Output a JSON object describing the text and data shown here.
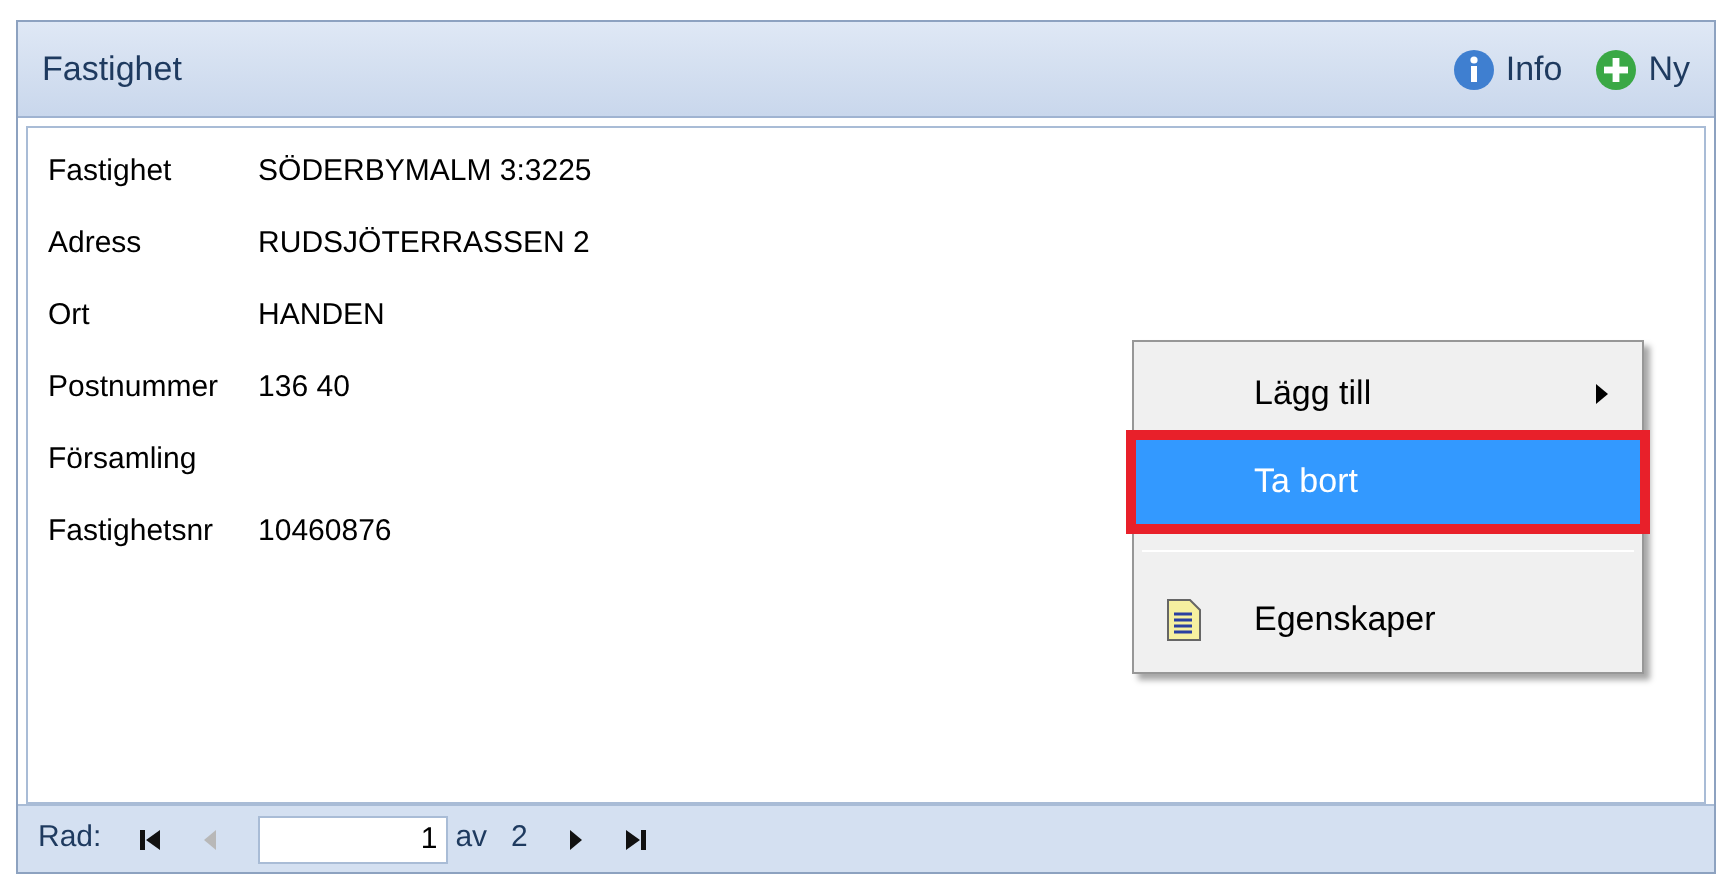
{
  "panel": {
    "title": "Fastighet",
    "actions": [
      {
        "kind": "info",
        "label": "Info"
      },
      {
        "kind": "add",
        "label": "Ny"
      }
    ]
  },
  "fields": [
    {
      "label": "Fastighet",
      "value": "SÖDERBYMALM 3:3225"
    },
    {
      "label": "Adress",
      "value": "RUDSJÖTERRASSEN 2"
    },
    {
      "label": "Ort",
      "value": "HANDEN"
    },
    {
      "label": "Postnummer",
      "value": "136 40"
    },
    {
      "label": "Församling"
    },
    {
      "label": "Fastighetsnr",
      "value": "10460876"
    }
  ],
  "context_menu": {
    "items": [
      {
        "kind": "submenu",
        "label": "Lägg till",
        "selected": false,
        "highlighted_box": false
      },
      {
        "kind": "plain",
        "label": "Ta bort",
        "selected": true,
        "highlighted_box": true
      },
      {
        "kind": "separator"
      },
      {
        "kind": "icon",
        "label": "Egenskaper",
        "selected": false,
        "highlighted_box": false
      }
    ]
  },
  "navigator": {
    "label": "Rad:",
    "value": "1",
    "of_label": "av",
    "total": "2",
    "previous_disabled": true
  }
}
